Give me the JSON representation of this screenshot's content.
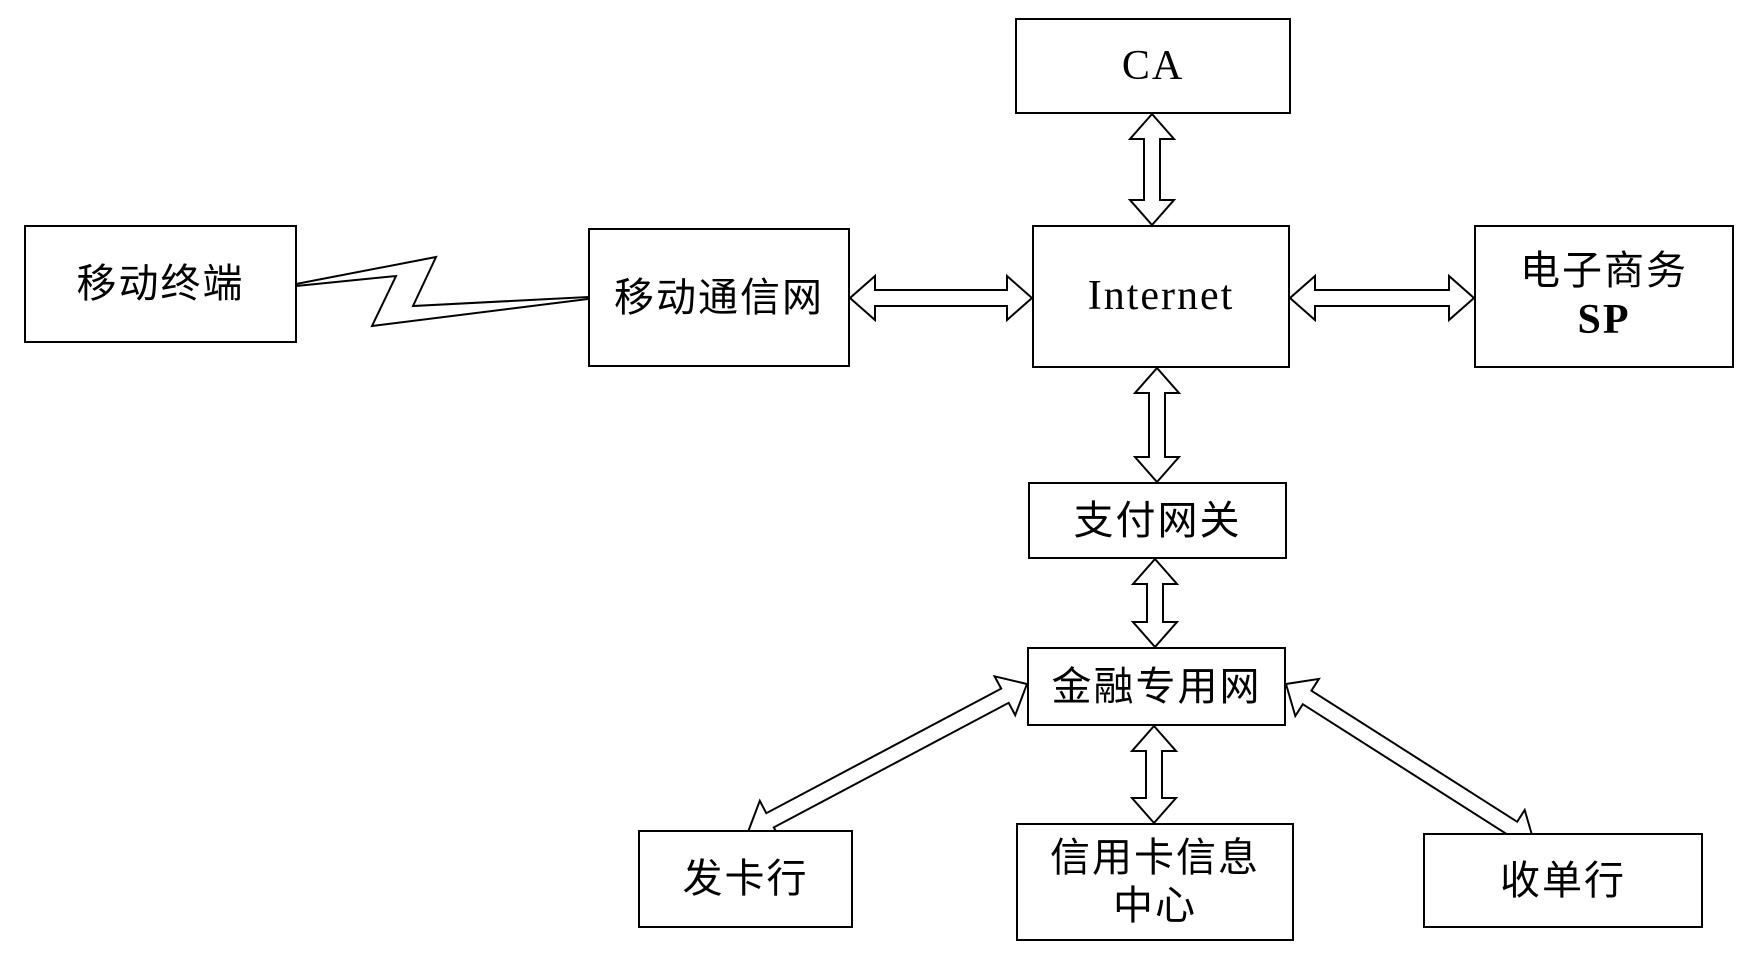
{
  "diagram": {
    "type": "mobile-payment-system-architecture",
    "nodes": {
      "mobile_terminal": {
        "label": "移动终端"
      },
      "mobile_network": {
        "label": "移动通信网"
      },
      "ca": {
        "label": "CA"
      },
      "internet": {
        "label": "Internet"
      },
      "ecommerce_sp": {
        "label_line1": "电子商务",
        "label_line2": "SP"
      },
      "payment_gateway": {
        "label": "支付网关"
      },
      "financial_network": {
        "label": "金融专用网"
      },
      "issuing_bank": {
        "label": "发卡行"
      },
      "credit_card_center": {
        "label_line1": "信用卡信息",
        "label_line2": "中心"
      },
      "acquiring_bank": {
        "label": "收单行"
      }
    },
    "edges": [
      {
        "from": "移动终端",
        "to": "移动通信网",
        "kind": "wireless-link"
      },
      {
        "from": "移动通信网",
        "to": "Internet",
        "kind": "bidirectional"
      },
      {
        "from": "CA",
        "to": "Internet",
        "kind": "bidirectional"
      },
      {
        "from": "Internet",
        "to": "电子商务SP",
        "kind": "bidirectional"
      },
      {
        "from": "Internet",
        "to": "支付网关",
        "kind": "bidirectional"
      },
      {
        "from": "支付网关",
        "to": "金融专用网",
        "kind": "bidirectional"
      },
      {
        "from": "金融专用网",
        "to": "发卡行",
        "kind": "bidirectional"
      },
      {
        "from": "金融专用网",
        "to": "信用卡信息中心",
        "kind": "bidirectional"
      },
      {
        "from": "金融专用网",
        "to": "收单行",
        "kind": "bidirectional"
      }
    ],
    "colors": {
      "stroke": "#000000",
      "fill": "#ffffff",
      "background": "#ffffff"
    }
  }
}
